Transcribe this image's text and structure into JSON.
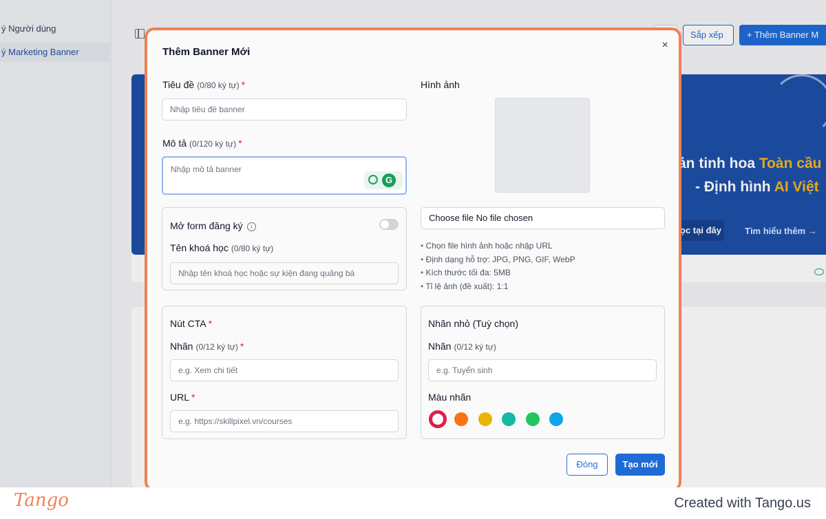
{
  "sidebar": {
    "items": [
      {
        "label": "ý Người dùng"
      },
      {
        "label": "ý Marketing Banner"
      }
    ]
  },
  "toolbar": {
    "sort_label": "Sắp xếp",
    "add_label": "+ Thêm Banner M"
  },
  "banner": {
    "line1_prefix": "ản tinh hoa ",
    "line1_highlight": "Toàn cầu",
    "line2_prefix": "- Định hình ",
    "line2_highlight": "AI Việt",
    "btn1": "ọc tại đây",
    "btn2": "Tìm hiểu thêm →"
  },
  "modal": {
    "title": "Thêm Banner Mới",
    "close": "×",
    "title_field": {
      "label": "Tiêu đề",
      "count": "(0/80 ký tự)",
      "required": "*",
      "placeholder": "Nhập tiêu đề banner"
    },
    "desc_field": {
      "label": "Mô tả",
      "count": "(0/120 ký tự)",
      "required": "*",
      "placeholder": "Nhập mô tả banner"
    },
    "form_section": {
      "label": "Mở form đăng ký",
      "info": "i",
      "course_label": "Tên khoá học",
      "course_count": "(0/80 ký tự)",
      "course_placeholder": "Nhập tên khoá học hoặc sự kiện đang quảng bá"
    },
    "image": {
      "label": "Hình ảnh",
      "file_button": "Choose file",
      "file_status": "No file chosen",
      "hints": [
        "Chọn file hình ảnh hoặc nhập URL",
        "Định dạng hỗ trợ: JPG, PNG, GIF, WebP",
        "Kích thước tối đa: 5MB",
        "Tỉ lệ ảnh (đề xuất): 1:1"
      ]
    },
    "cta": {
      "title": "Nút CTA",
      "required": "*",
      "label_label": "Nhãn",
      "label_count": "(0/12 ký tự)",
      "label_placeholder": "e.g. Xem chi tiết",
      "url_label": "URL",
      "url_placeholder": "e.g. https://skillpixel.vn/courses"
    },
    "tag": {
      "title": "Nhãn nhỏ (Tuỳ chọn)",
      "label_label": "Nhãn",
      "label_count": "(0/12 ký tự)",
      "label_placeholder": "e.g. Tuyển sinh",
      "color_label": "Màu nhãn",
      "colors": [
        "#e11d48",
        "#f97316",
        "#eab308",
        "#14b8a6",
        "#22c55e",
        "#0ea5e9"
      ]
    },
    "buttons": {
      "close": "Đóng",
      "create": "Tạo mới"
    }
  },
  "footer": {
    "logo": "Tango",
    "credit": "Created with Tango.us"
  }
}
